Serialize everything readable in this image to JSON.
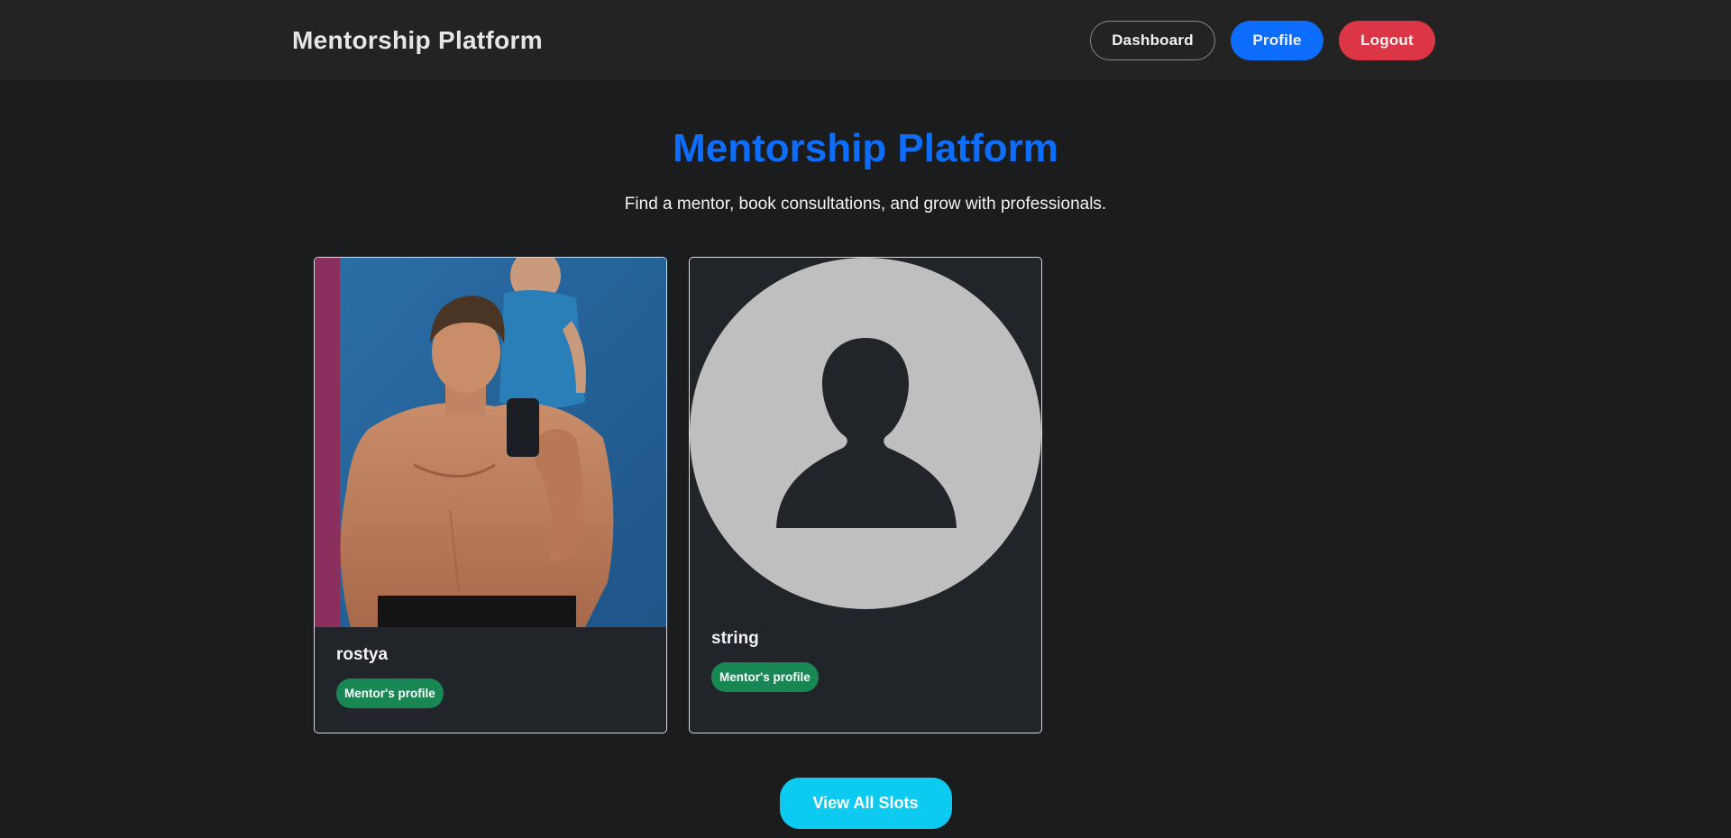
{
  "navbar": {
    "brand": "Mentorship Platform",
    "dashboard_label": "Dashboard",
    "profile_label": "Profile",
    "logout_label": "Logout"
  },
  "hero": {
    "title": "Mentorship Platform",
    "subtitle": "Find a mentor, book consultations, and grow with professionals."
  },
  "mentors": [
    {
      "name": "rostya",
      "badge": "Mentor's profile",
      "photo": "profile-photo"
    },
    {
      "name": "string",
      "badge": "Mentor's profile",
      "photo": "default-avatar-icon"
    }
  ],
  "cta": {
    "label": "View All Slots"
  },
  "colors": {
    "primary": "#0d6efd",
    "danger": "#dc3545",
    "success": "#198754",
    "info": "#0dcaf0",
    "background": "#1b1c1e",
    "navbar": "#232323",
    "card": "#212429"
  }
}
